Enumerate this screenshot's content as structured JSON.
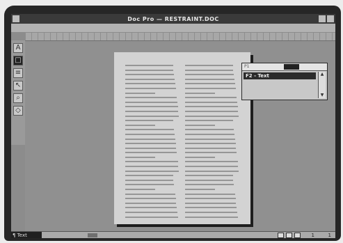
{
  "window": {
    "title": "Doc Pro — RESTRAINT.DOC"
  },
  "palette": {
    "header": "P1",
    "selected_item": "F2 - Text",
    "scroll_up": "▲",
    "scroll_down": "▼"
  },
  "statusbar": {
    "style": "¶ Text",
    "page": "1",
    "total": "1"
  }
}
